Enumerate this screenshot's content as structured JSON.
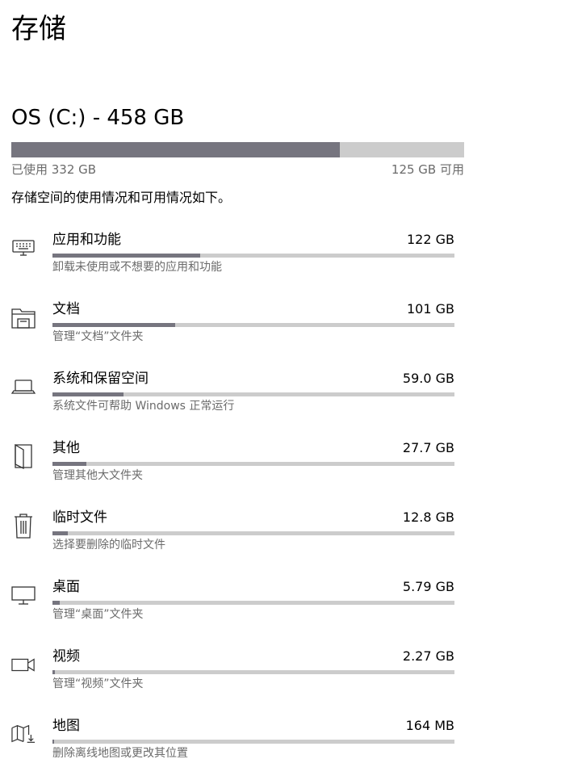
{
  "page": {
    "title": "存储"
  },
  "drive": {
    "title": "OS (C:) - 458 GB",
    "used_label": "已使用 332 GB",
    "free_label": "125 GB 可用",
    "used_fraction": 0.725
  },
  "description": "存储空间的使用情况和可用情况如下。",
  "colors": {
    "bar_fill": "#76757f",
    "bar_track": "#cccccc",
    "secondary_text": "#6b6b6b"
  },
  "categories": [
    {
      "name": "应用和功能",
      "size": "122 GB",
      "subtitle": "卸载未使用或不想要的应用和功能",
      "icon": "keyboard-icon",
      "fraction": 0.367
    },
    {
      "name": "文档",
      "size": "101 GB",
      "subtitle": "管理“文档”文件夹",
      "icon": "folder-icon",
      "fraction": 0.306
    },
    {
      "name": "系统和保留空间",
      "size": "59.0 GB",
      "subtitle": "系统文件可帮助 Windows 正常运行",
      "icon": "laptop-icon",
      "fraction": 0.176
    },
    {
      "name": "其他",
      "size": "27.7 GB",
      "subtitle": "管理其他大文件夹",
      "icon": "open-folder-icon",
      "fraction": 0.084
    },
    {
      "name": "临时文件",
      "size": "12.8 GB",
      "subtitle": "选择要删除的临时文件",
      "icon": "trash-icon",
      "fraction": 0.038
    },
    {
      "name": "桌面",
      "size": "5.79 GB",
      "subtitle": "管理“桌面”文件夹",
      "icon": "monitor-icon",
      "fraction": 0.018
    },
    {
      "name": "视频",
      "size": "2.27 GB",
      "subtitle": "管理“视频”文件夹",
      "icon": "video-camera-icon",
      "fraction": 0.007
    },
    {
      "name": "地图",
      "size": "164 MB",
      "subtitle": "删除离线地图或更改其位置",
      "icon": "map-icon",
      "fraction": 0.001
    }
  ]
}
